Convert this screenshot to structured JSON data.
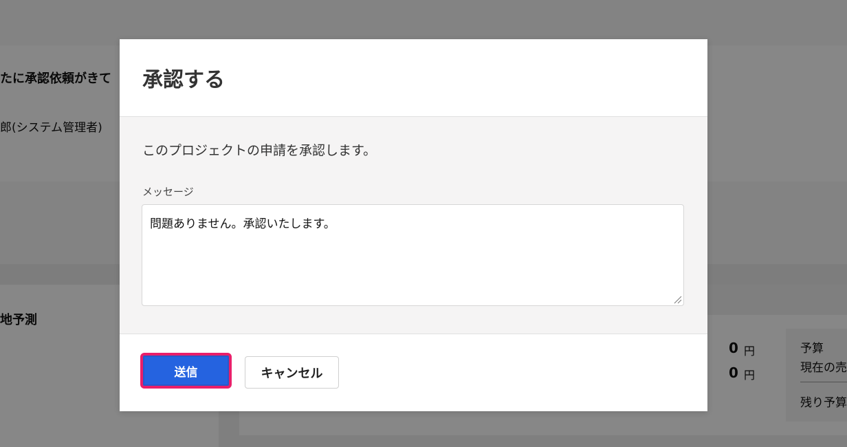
{
  "background": {
    "notification_title_fragment": "たに承認依頼がきて",
    "requester_fragment": "郎(システム管理者)",
    "section_fragment": "地予測",
    "amount_1": "0",
    "amount_2": "0",
    "currency": "円",
    "budget_label": "予算",
    "current_sales_fragment": "現在の売",
    "remaining_budget_fragment": "残り予算"
  },
  "modal": {
    "title": "承認する",
    "description": "このプロジェクトの申請を承認します。",
    "message_label": "メッセージ",
    "message_value": "問題ありません。承認いたします。",
    "send_label": "送信",
    "cancel_label": "キャンセル"
  },
  "colors": {
    "send_button": "#2563e0",
    "focus_ring": "#ea1f6a",
    "overlay": "#808080"
  }
}
